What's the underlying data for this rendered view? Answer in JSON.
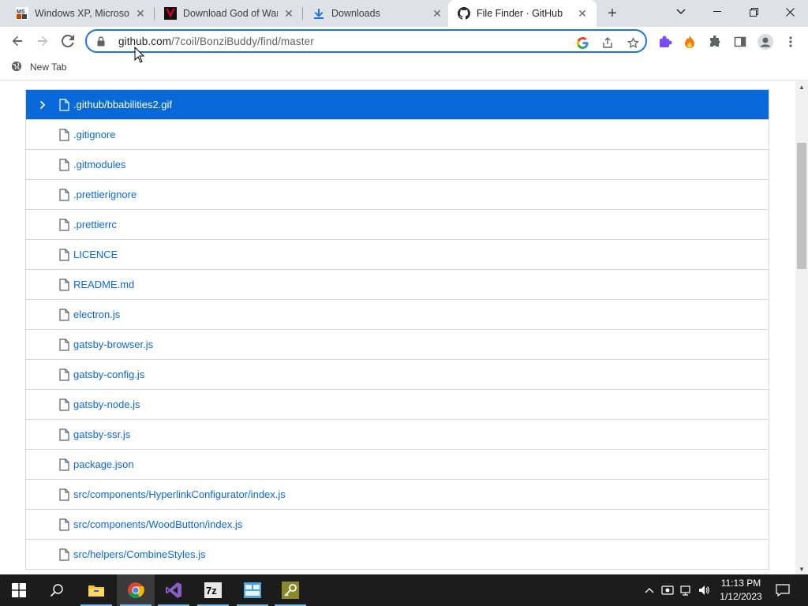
{
  "browser": {
    "tabs": [
      {
        "title": "Windows XP, Microsoft",
        "favicon": "ms-icon",
        "active": false
      },
      {
        "title": "Download God of War",
        "favicon": "red-v-icon",
        "active": false
      },
      {
        "title": "Downloads",
        "favicon": "download-icon",
        "active": false
      },
      {
        "title": "File Finder · GitHub",
        "favicon": "github-icon",
        "active": true
      }
    ],
    "address": {
      "host": "github.com",
      "path": "/7coil/BonziBuddy/find/master"
    },
    "bookmarks": [
      {
        "label": "New Tab",
        "icon": "globe-icon"
      }
    ]
  },
  "file_finder": {
    "files": [
      ".github/bbabilities2.gif",
      ".gitignore",
      ".gitmodules",
      ".prettierignore",
      ".prettierrc",
      "LICENCE",
      "README.md",
      "electron.js",
      "gatsby-browser.js",
      "gatsby-config.js",
      "gatsby-node.js",
      "gatsby-ssr.js",
      "package.json",
      "src/components/HyperlinkConfigurator/index.js",
      "src/components/WoodButton/index.js",
      "src/helpers/CombineStyles.js"
    ],
    "selected_index": 0
  },
  "taskbar": {
    "apps": [
      {
        "name": "file-explorer-icon"
      },
      {
        "name": "chrome-icon"
      },
      {
        "name": "visual-studio-icon"
      },
      {
        "name": "7zip-icon"
      },
      {
        "name": "control-panel-icon"
      },
      {
        "name": "key-app-icon"
      }
    ],
    "clock": {
      "time": "11:13 PM",
      "date": "1/12/2023"
    }
  },
  "colors": {
    "selected_row": "#0969da",
    "link": "#0969da",
    "focus_ring": "#1a73e8",
    "tabstrip": "#dee1e6"
  }
}
